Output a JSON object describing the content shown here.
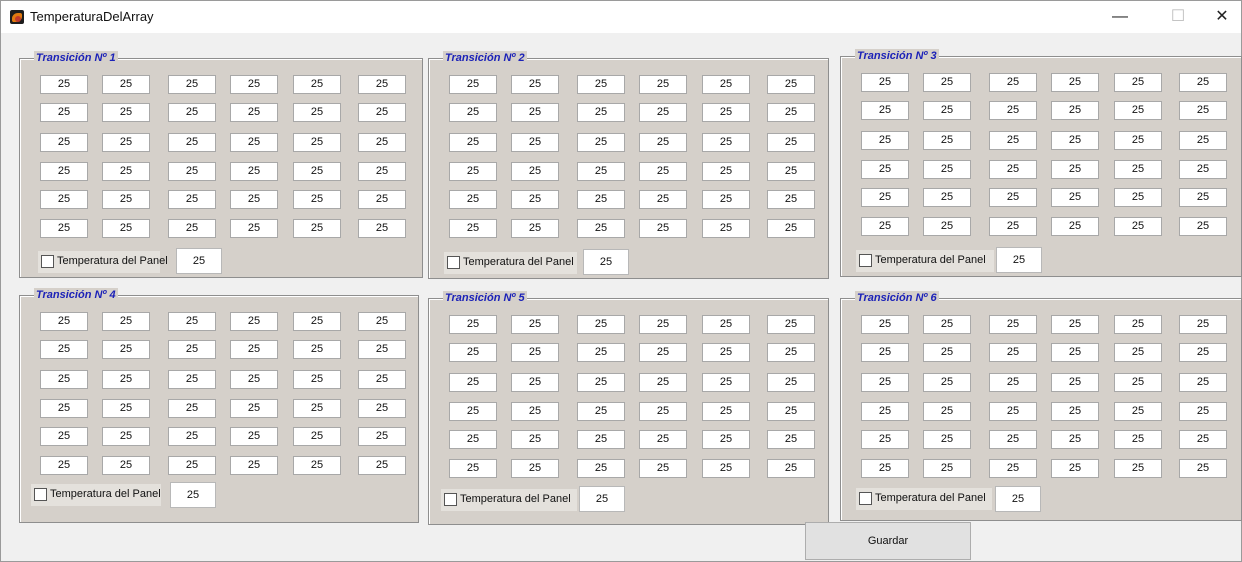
{
  "window": {
    "title": "TemperaturaDelArray",
    "minimize_glyph": "—",
    "maximize_glyph": "☐",
    "close_glyph": "✕"
  },
  "panels": [
    {
      "title": "Transición Nº 1",
      "checkbox_label": "Temperatura del Panel",
      "checked": false,
      "panel_value": "25",
      "grid": [
        [
          "25",
          "25",
          "25",
          "25",
          "25",
          "25"
        ],
        [
          "25",
          "25",
          "25",
          "25",
          "25",
          "25"
        ],
        [
          "25",
          "25",
          "25",
          "25",
          "25",
          "25"
        ],
        [
          "25",
          "25",
          "25",
          "25",
          "25",
          "25"
        ],
        [
          "25",
          "25",
          "25",
          "25",
          "25",
          "25"
        ],
        [
          "25",
          "25",
          "25",
          "25",
          "25",
          "25"
        ]
      ]
    },
    {
      "title": "Transición Nº 2",
      "checkbox_label": "Temperatura del Panel",
      "checked": false,
      "panel_value": "25",
      "grid": [
        [
          "25",
          "25",
          "25",
          "25",
          "25",
          "25"
        ],
        [
          "25",
          "25",
          "25",
          "25",
          "25",
          "25"
        ],
        [
          "25",
          "25",
          "25",
          "25",
          "25",
          "25"
        ],
        [
          "25",
          "25",
          "25",
          "25",
          "25",
          "25"
        ],
        [
          "25",
          "25",
          "25",
          "25",
          "25",
          "25"
        ],
        [
          "25",
          "25",
          "25",
          "25",
          "25",
          "25"
        ]
      ]
    },
    {
      "title": "Transición Nº 3",
      "checkbox_label": "Temperatura del Panel",
      "checked": false,
      "panel_value": "25",
      "grid": [
        [
          "25",
          "25",
          "25",
          "25",
          "25",
          "25"
        ],
        [
          "25",
          "25",
          "25",
          "25",
          "25",
          "25"
        ],
        [
          "25",
          "25",
          "25",
          "25",
          "25",
          "25"
        ],
        [
          "25",
          "25",
          "25",
          "25",
          "25",
          "25"
        ],
        [
          "25",
          "25",
          "25",
          "25",
          "25",
          "25"
        ],
        [
          "25",
          "25",
          "25",
          "25",
          "25",
          "25"
        ]
      ]
    },
    {
      "title": "Transición Nº 4",
      "checkbox_label": "Temperatura del Panel",
      "checked": false,
      "panel_value": "25",
      "grid": [
        [
          "25",
          "25",
          "25",
          "25",
          "25",
          "25"
        ],
        [
          "25",
          "25",
          "25",
          "25",
          "25",
          "25"
        ],
        [
          "25",
          "25",
          "25",
          "25",
          "25",
          "25"
        ],
        [
          "25",
          "25",
          "25",
          "25",
          "25",
          "25"
        ],
        [
          "25",
          "25",
          "25",
          "25",
          "25",
          "25"
        ],
        [
          "25",
          "25",
          "25",
          "25",
          "25",
          "25"
        ]
      ]
    },
    {
      "title": "Transición Nº 5",
      "checkbox_label": "Temperatura del Panel",
      "checked": false,
      "panel_value": "25",
      "grid": [
        [
          "25",
          "25",
          "25",
          "25",
          "25",
          "25"
        ],
        [
          "25",
          "25",
          "25",
          "25",
          "25",
          "25"
        ],
        [
          "25",
          "25",
          "25",
          "25",
          "25",
          "25"
        ],
        [
          "25",
          "25",
          "25",
          "25",
          "25",
          "25"
        ],
        [
          "25",
          "25",
          "25",
          "25",
          "25",
          "25"
        ],
        [
          "25",
          "25",
          "25",
          "25",
          "25",
          "25"
        ]
      ]
    },
    {
      "title": "Transición Nº 6",
      "checkbox_label": "Temperatura del Panel",
      "checked": false,
      "panel_value": "25",
      "grid": [
        [
          "25",
          "25",
          "25",
          "25",
          "25",
          "25"
        ],
        [
          "25",
          "25",
          "25",
          "25",
          "25",
          "25"
        ],
        [
          "25",
          "25",
          "25",
          "25",
          "25",
          "25"
        ],
        [
          "25",
          "25",
          "25",
          "25",
          "25",
          "25"
        ],
        [
          "25",
          "25",
          "25",
          "25",
          "25",
          "25"
        ],
        [
          "25",
          "25",
          "25",
          "25",
          "25",
          "25"
        ]
      ]
    }
  ],
  "save_button_label": "Guardar",
  "colors": {
    "panel_background": "#d5d0ca",
    "panel_title": "#1c22b8",
    "window_background": "#f0f0f0"
  }
}
